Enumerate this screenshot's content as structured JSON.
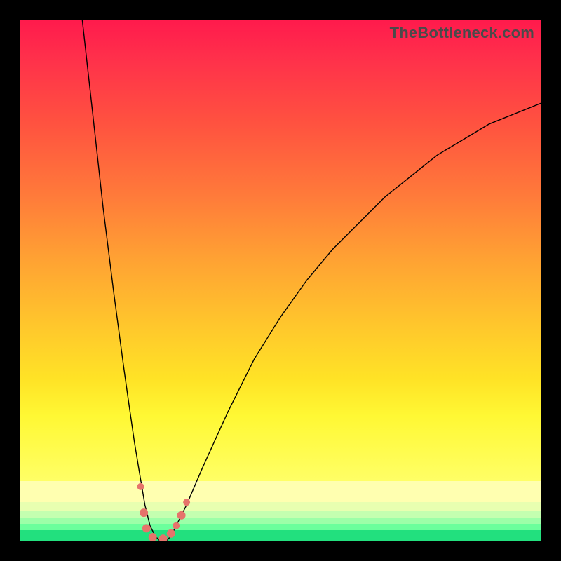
{
  "watermark": "TheBottleneck.com",
  "colors": {
    "curve": "#000000",
    "marker": "#e6736b",
    "frame": "#000000",
    "gradient_top": "#ff1a4c",
    "gradient_bottom": "#22e07e"
  },
  "chart_data": {
    "type": "line",
    "title": "",
    "xlabel": "",
    "ylabel": "",
    "xlim": [
      0,
      100
    ],
    "ylim": [
      0,
      100
    ],
    "description": "Bottleneck curve: sharp V shape with minimum near x≈26; left branch nearly vertical, right branch rises concave toward upper-right. Background is a vertical red→yellow→green gradient where green (bottom ~2%) is the optimal match band.",
    "series": [
      {
        "name": "bottleneck-curve",
        "style": "line",
        "x": [
          12,
          14,
          16,
          18,
          20,
          21,
          22,
          23,
          24,
          25,
          26,
          27,
          28,
          29,
          30,
          32,
          35,
          40,
          45,
          50,
          55,
          60,
          65,
          70,
          75,
          80,
          85,
          90,
          95,
          100
        ],
        "y": [
          100,
          82,
          64,
          48,
          33,
          26,
          19,
          13,
          7,
          3,
          1,
          0,
          0,
          1,
          3,
          7,
          14,
          25,
          35,
          43,
          50,
          56,
          61,
          66,
          70,
          74,
          77,
          80,
          82,
          84
        ]
      },
      {
        "name": "markers",
        "style": "scatter",
        "points": [
          {
            "x": 23.2,
            "y": 10.5,
            "r": 5
          },
          {
            "x": 23.8,
            "y": 5.5,
            "r": 6
          },
          {
            "x": 24.3,
            "y": 2.5,
            "r": 6
          },
          {
            "x": 25.5,
            "y": 0.8,
            "r": 6
          },
          {
            "x": 27.5,
            "y": 0.5,
            "r": 6
          },
          {
            "x": 29.0,
            "y": 1.5,
            "r": 6
          },
          {
            "x": 30.0,
            "y": 3.0,
            "r": 5
          },
          {
            "x": 31.0,
            "y": 5.0,
            "r": 6
          },
          {
            "x": 32.0,
            "y": 7.5,
            "r": 5
          }
        ]
      }
    ]
  }
}
